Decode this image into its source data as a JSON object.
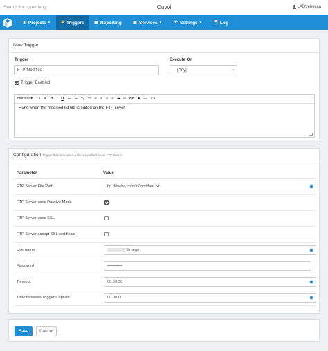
{
  "topbar": {
    "search_placeholder": "Search for something...",
    "app_title": "Ouvvi",
    "user_name": "LAB\\rebecca"
  },
  "nav": {
    "items": [
      {
        "label": "Projects",
        "icon": "book-icon",
        "caret": true
      },
      {
        "label": "Triggers",
        "icon": "bolt-icon",
        "caret": false,
        "active": true
      },
      {
        "label": "Reporting",
        "icon": "bar-chart-icon",
        "caret": false
      },
      {
        "label": "Services",
        "icon": "cubes-icon",
        "caret": true
      },
      {
        "label": "Settings",
        "icon": "wrench-icon",
        "caret": true
      },
      {
        "label": "Log",
        "icon": "list-icon",
        "caret": false
      }
    ]
  },
  "new_trigger": {
    "heading": "New Trigger",
    "trigger_label": "Trigger",
    "trigger_value": "FTP-Modified",
    "execute_label": "Execute On",
    "execute_value": "[Any]",
    "enabled_label": "Trigger Enabled",
    "enabled": true,
    "editor": {
      "format_label": "Normal",
      "toolbar": [
        "TT",
        "A",
        "B",
        "I",
        "U",
        "☰",
        "☰",
        "x₂",
        "x²",
        "≡",
        "≡",
        "≡",
        "≡",
        "S",
        "∞",
        "qb",
        "♣",
        "—",
        "<>"
      ],
      "content": "Runs when the modified txt file is edited on the FTP sever."
    }
  },
  "configuration": {
    "heading": "Configuration",
    "subheading": "Trigger that runs when a file is modified on an FTP Server.",
    "col_parameter": "Parameter",
    "col_value": "Value",
    "rows": [
      {
        "name": "FTP Server File Path",
        "type": "text",
        "value": "ftp.drivehq.com/in/modified.txt",
        "gear": true
      },
      {
        "name": "FTP Server uses Passive Mode",
        "type": "check",
        "checked": true
      },
      {
        "name": "FTP Server uses SSL",
        "type": "check",
        "checked": false
      },
      {
        "name": "FTP Server accept SSL certificate",
        "type": "check",
        "checked": false
      },
      {
        "name": "Username",
        "type": "text",
        "value": "Simego",
        "gear": true,
        "blurred_prefix": true
      },
      {
        "name": "Password",
        "type": "text",
        "value": "•••••••••••",
        "gear": false
      },
      {
        "name": "Timeout",
        "type": "text",
        "value": "00:00:30",
        "gear": true
      },
      {
        "name": "Time between Trigger Capture",
        "type": "text",
        "value": "00:00:00",
        "gear": true
      }
    ]
  },
  "footer": {
    "save_label": "Save",
    "cancel_label": "Cancel"
  },
  "colors": {
    "brand": "#1e8fd6",
    "brand_dark": "#126aa5"
  }
}
